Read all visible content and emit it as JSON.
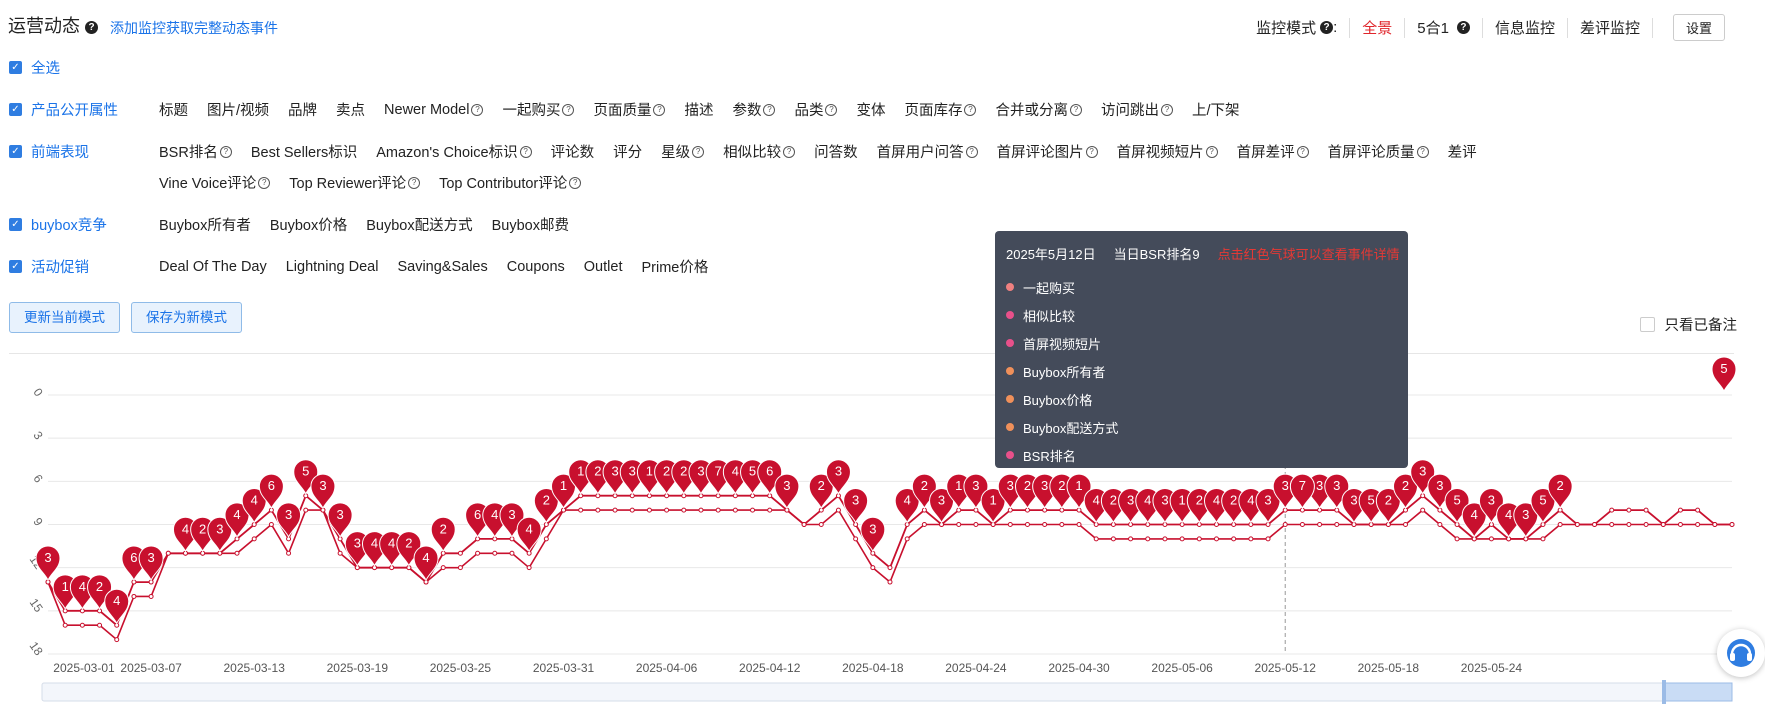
{
  "header": {
    "title": "运营动态",
    "help_icon": "question-circle-icon",
    "add_monitor_link": "添加监控获取完整动态事件"
  },
  "monitor": {
    "label": "监控模式",
    "colon": ":",
    "modes": [
      {
        "label": "全景",
        "active": true
      },
      {
        "label": "5合1",
        "help": true
      },
      {
        "label": "信息监控"
      },
      {
        "label": "差评监控"
      }
    ],
    "settings_button": "设置"
  },
  "select_all": "全选",
  "categories": [
    {
      "name": "产品公开属性",
      "items": [
        {
          "l": "标题"
        },
        {
          "l": "图片/视频"
        },
        {
          "l": "品牌"
        },
        {
          "l": "卖点"
        },
        {
          "l": "Newer Model",
          "q": true
        },
        {
          "l": "一起购买",
          "q": true
        },
        {
          "l": "页面质量",
          "q": true
        },
        {
          "l": "描述"
        },
        {
          "l": "参数",
          "q": true
        },
        {
          "l": "品类",
          "q": true
        },
        {
          "l": "变体"
        },
        {
          "l": "页面库存",
          "q": true
        },
        {
          "l": "合并或分离",
          "q": true
        },
        {
          "l": "访问跳出",
          "q": true
        },
        {
          "l": "上/下架"
        }
      ]
    },
    {
      "name": "前端表现",
      "items": [
        {
          "l": "BSR排名",
          "q": true
        },
        {
          "l": "Best Sellers标识"
        },
        {
          "l": "Amazon's Choice标识",
          "q": true
        },
        {
          "l": "评论数"
        },
        {
          "l": "评分"
        },
        {
          "l": "星级",
          "q": true
        },
        {
          "l": "相似比较",
          "q": true
        },
        {
          "l": "问答数"
        },
        {
          "l": "首屏用户问答",
          "q": true
        },
        {
          "l": "首屏评论图片",
          "q": true
        },
        {
          "l": "首屏视频短片",
          "q": true
        },
        {
          "l": "首屏差评",
          "q": true
        },
        {
          "l": "首屏评论质量",
          "q": true
        },
        {
          "l": "差评"
        },
        {
          "l": "Vine Voice评论",
          "q": true
        },
        {
          "l": "Top Reviewer评论",
          "q": true
        },
        {
          "l": "Top Contributor评论",
          "q": true
        }
      ]
    },
    {
      "name": "buybox竞争",
      "items": [
        {
          "l": "Buybox所有者"
        },
        {
          "l": "Buybox价格"
        },
        {
          "l": "Buybox配送方式"
        },
        {
          "l": "Buybox邮费"
        }
      ]
    },
    {
      "name": "活动促销",
      "items": [
        {
          "l": "Deal Of The Day"
        },
        {
          "l": "Lightning Deal"
        },
        {
          "l": "Saving&Sales"
        },
        {
          "l": "Coupons"
        },
        {
          "l": "Outlet"
        },
        {
          "l": "Prime价格"
        }
      ]
    }
  ],
  "mode_buttons": {
    "update": "更新当前模式",
    "save_new": "保存为新模式"
  },
  "only_noted": "只看已备注",
  "tooltip": {
    "date": "2025年5月12日",
    "rank_text": "当日BSR排名9",
    "hint": "点击红色气球可以查看事件详情",
    "events": [
      {
        "label": "一起购买",
        "color": "#f08080"
      },
      {
        "label": "相似比较",
        "color": "#e8508a"
      },
      {
        "label": "首屏视频短片",
        "color": "#e8508a"
      },
      {
        "label": "Buybox所有者",
        "color": "#f0905a"
      },
      {
        "label": "Buybox价格",
        "color": "#f0905a"
      },
      {
        "label": "Buybox配送方式",
        "color": "#f0905a"
      },
      {
        "label": "BSR排名",
        "color": "#e8508a"
      }
    ]
  },
  "colors": {
    "accent": "#1a73e8",
    "line": "#c8102e",
    "balloon": "#c8102e",
    "tooltip_bg": "#444b5a"
  },
  "chart_data": {
    "type": "line",
    "ylim": [
      0,
      18
    ],
    "y_ticks": [
      "0",
      "3",
      "6",
      "9",
      "12",
      "15",
      "18"
    ],
    "y_reversed": true,
    "x_tick_labels": [
      "2025-03-01",
      "2025-03-07",
      "2025-03-13",
      "2025-03-19",
      "2025-03-25",
      "2025-03-31",
      "2025-04-06",
      "2025-04-12",
      "2025-04-18",
      "2025-04-24",
      "2025-04-30",
      "2025-05-06",
      "2025-05-12",
      "2025-05-18",
      "2025-05-24"
    ],
    "x_start": "2025-03-01",
    "highlight_date": "2025-05-12",
    "bsr_rank": [
      13,
      15,
      15,
      15,
      16,
      13,
      13,
      11,
      11,
      11,
      11,
      10,
      9,
      8,
      10,
      7,
      8,
      10,
      12,
      12,
      12,
      12,
      13,
      11,
      11,
      10,
      10,
      10,
      11,
      9,
      8,
      7,
      7,
      7,
      7,
      7,
      7,
      7,
      7,
      7,
      7,
      7,
      7,
      8,
      9,
      8,
      7,
      9,
      11,
      12,
      9,
      8,
      9,
      8,
      8,
      9,
      8,
      8,
      8,
      8,
      8,
      9,
      9,
      9,
      9,
      9,
      9,
      9,
      9,
      9,
      9,
      9,
      8,
      8,
      8,
      8,
      9,
      9,
      9,
      8,
      7,
      8,
      9,
      10,
      9,
      10,
      10,
      9,
      8,
      9,
      9,
      8,
      8,
      8,
      9,
      8,
      8,
      9,
      9
    ],
    "bsr_lower": [
      13,
      16,
      16,
      16,
      17,
      14,
      14,
      11,
      11,
      11,
      11,
      11,
      10,
      9,
      11,
      8,
      8,
      11,
      12,
      12,
      12,
      12,
      13,
      12,
      12,
      11,
      11,
      11,
      12,
      10,
      8,
      8,
      8,
      8,
      8,
      8,
      8,
      8,
      8,
      8,
      8,
      8,
      8,
      8,
      9,
      9,
      8,
      10,
      12,
      13,
      10,
      9,
      9,
      9,
      9,
      9,
      9,
      9,
      9,
      9,
      9,
      10,
      10,
      10,
      10,
      10,
      10,
      10,
      10,
      10,
      10,
      10,
      9,
      9,
      9,
      9,
      9,
      9,
      9,
      9,
      8,
      9,
      10,
      10,
      10,
      10,
      10,
      10,
      9,
      9,
      9,
      9,
      9,
      9,
      9,
      9,
      9,
      9,
      9
    ],
    "event_counts": [
      3,
      1,
      4,
      2,
      4,
      6,
      3,
      4,
      2,
      3,
      4,
      4,
      6,
      3,
      5,
      3,
      3,
      3,
      4,
      4,
      2,
      4,
      2,
      6,
      4,
      3,
      4,
      2,
      1,
      1,
      2,
      3,
      3,
      1,
      2,
      2,
      3,
      7,
      4,
      5,
      6,
      3,
      2,
      3,
      3,
      3,
      4,
      2,
      3,
      1,
      3,
      1,
      3,
      2,
      3,
      2,
      1,
      4,
      2,
      3,
      4,
      3,
      1,
      2,
      4,
      2,
      4,
      3,
      3,
      3,
      3,
      7,
      3,
      3,
      5,
      2,
      2,
      3,
      3,
      5,
      4,
      3,
      4,
      3,
      5,
      2
    ],
    "event_dates": [
      0,
      1,
      2,
      3,
      4,
      5,
      6,
      8,
      9,
      10,
      11,
      12,
      13,
      14,
      15,
      16,
      17,
      18,
      19,
      20,
      21,
      22,
      23,
      25,
      26,
      27,
      28,
      29,
      30,
      31,
      32,
      33,
      34,
      35,
      36,
      37,
      38,
      39,
      40,
      41,
      42,
      43,
      45,
      46,
      47,
      48,
      50,
      51,
      52,
      53,
      54,
      55,
      56,
      57,
      58,
      59,
      60,
      61,
      62,
      63,
      64,
      65,
      66,
      67,
      68,
      69,
      70,
      71,
      72,
      73,
      74,
      73,
      75,
      76,
      77,
      78,
      79,
      80,
      81,
      82,
      83,
      84,
      85,
      86,
      87,
      88
    ],
    "end_balloon": 5
  }
}
